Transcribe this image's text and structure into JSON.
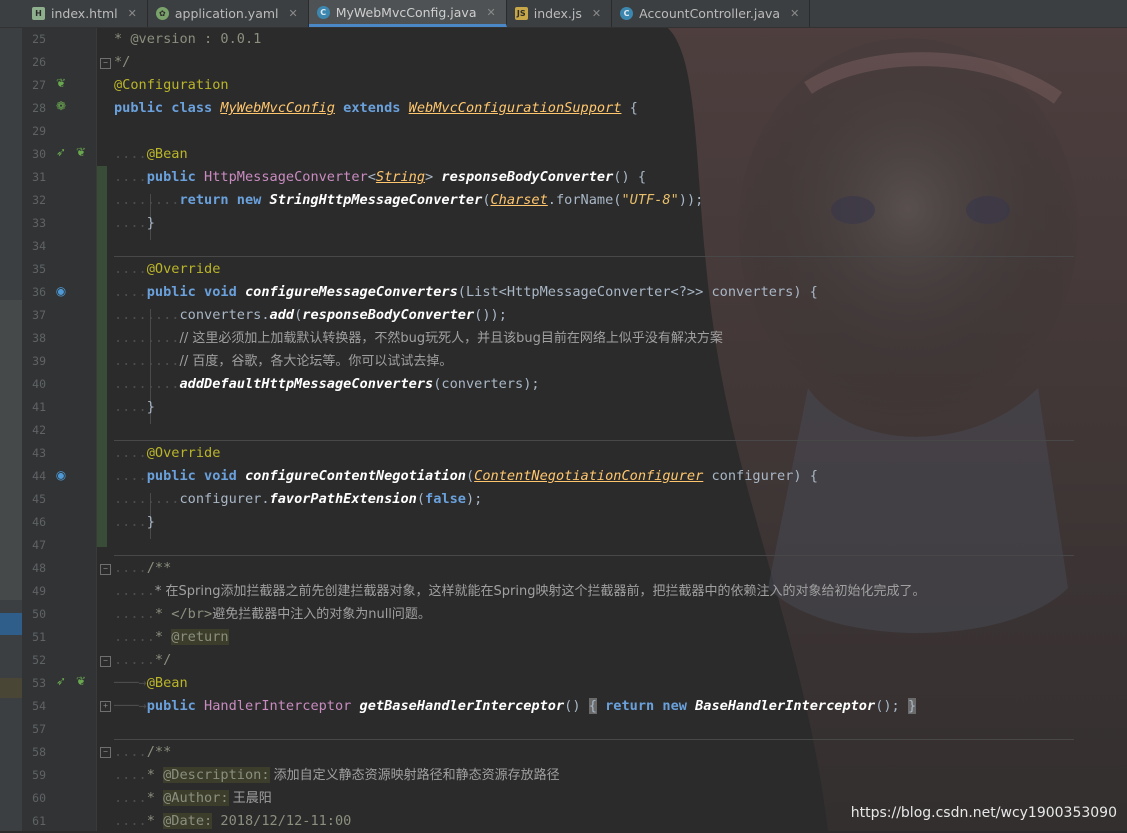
{
  "tabs": [
    {
      "label": "index.html",
      "icon": "html-file-icon",
      "active": false
    },
    {
      "label": "application.yaml",
      "icon": "yaml-file-icon",
      "active": false
    },
    {
      "label": "MyWebMvcConfig.java",
      "icon": "java-class-icon",
      "active": true
    },
    {
      "label": "index.js",
      "icon": "js-file-icon",
      "active": false
    },
    {
      "label": "AccountController.java",
      "icon": "java-class-icon",
      "active": false
    }
  ],
  "line_numbers": [
    "25",
    "26",
    "27",
    "28",
    "29",
    "30",
    "31",
    "32",
    "33",
    "34",
    "35",
    "36",
    "37",
    "38",
    "39",
    "40",
    "41",
    "42",
    "43",
    "44",
    "45",
    "46",
    "47",
    "48",
    "49",
    "50",
    "51",
    "52",
    "53",
    "54",
    "57",
    "58",
    "59",
    "60",
    "61"
  ],
  "code": {
    "l25": "* @version : 0.0.1",
    "l26": "*/",
    "l27": "@Configuration",
    "l28_a": "public class ",
    "l28_b": "MyWebMvcConfig",
    "l28_c": " extends ",
    "l28_d": "WebMvcConfigurationSupport",
    "l28_e": " {",
    "l30": "@Bean",
    "l31_a": "public ",
    "l31_b": "HttpMessageConverter",
    "l31_c": "<",
    "l31_d": "String",
    "l31_e": "> ",
    "l31_f": "responseBodyConverter",
    "l31_g": "() {",
    "l32_a": "return new ",
    "l32_b": "StringHttpMessageConverter",
    "l32_c": "(",
    "l32_d": "Charset",
    "l32_e": ".forName(",
    "l32_f": "\"UTF-8\"",
    "l32_g": "));",
    "l33": "}",
    "l35": "@Override",
    "l36_a": "public void ",
    "l36_b": "configureMessageConverters",
    "l36_c": "(List<HttpMessageConverter<?>> converters) {",
    "l37_a": "converters.",
    "l37_b": "add",
    "l37_c": "(",
    "l37_d": "responseBodyConverter",
    "l37_e": "());",
    "l38": "// 这里必须加上加载默认转换器，不然bug玩死人，并且该bug目前在网络上似乎没有解决方案",
    "l39": "// 百度，谷歌，各大论坛等。你可以试试去掉。",
    "l40_a": "addDefaultHttpMessageConverters",
    "l40_b": "(converters);",
    "l41": "}",
    "l43": "@Override",
    "l44_a": "public void ",
    "l44_b": "configureContentNegotiation",
    "l44_c": "(",
    "l44_d": "ContentNegotiationConfigurer",
    "l44_e": " configurer) {",
    "l45_a": "configurer.",
    "l45_b": "favorPathExtension",
    "l45_c": "(",
    "l45_d": "false",
    "l45_e": ");",
    "l46": "}",
    "l48": "/**",
    "l49": "* 在Spring添加拦截器之前先创建拦截器对象，这样就能在Spring映射这个拦截器前，把拦截器中的依赖注入的对象给初始化完成了。",
    "l50_a": "* ",
    "l50_b": "</br>",
    "l50_c": "避免拦截器中注入的对象为null问题。",
    "l51_a": "* ",
    "l51_b": "@return",
    "l52": "*/",
    "l53": "@Bean",
    "l54_a": "public ",
    "l54_b": "HandlerInterceptor ",
    "l54_c": "getBaseHandlerInterceptor",
    "l54_d": "() ",
    "l54_e": "{",
    "l54_f": " return new ",
    "l54_g": "BaseHandlerInterceptor",
    "l54_h": "(); ",
    "l54_i": "}",
    "l58": "/**",
    "l59_a": "* ",
    "l59_b": "@Description:",
    "l59_c": " 添加自定义静态资源映射路径和静态资源存放路径",
    "l60_a": "* ",
    "l60_b": "@Author:",
    "l60_c": " 王晨阳",
    "l61_a": "* ",
    "l61_b": "@Date:",
    "l61_c": " 2018/12/12-11:00"
  },
  "watermark": "https://blog.csdn.net/wcy1900353090",
  "colors": {
    "editor_bg": "#2b2b2b",
    "keyword": "#cc7832",
    "annotation": "#bbb529",
    "string": "#e8bf6a",
    "comment": "#808080",
    "method": "#ffffff"
  }
}
